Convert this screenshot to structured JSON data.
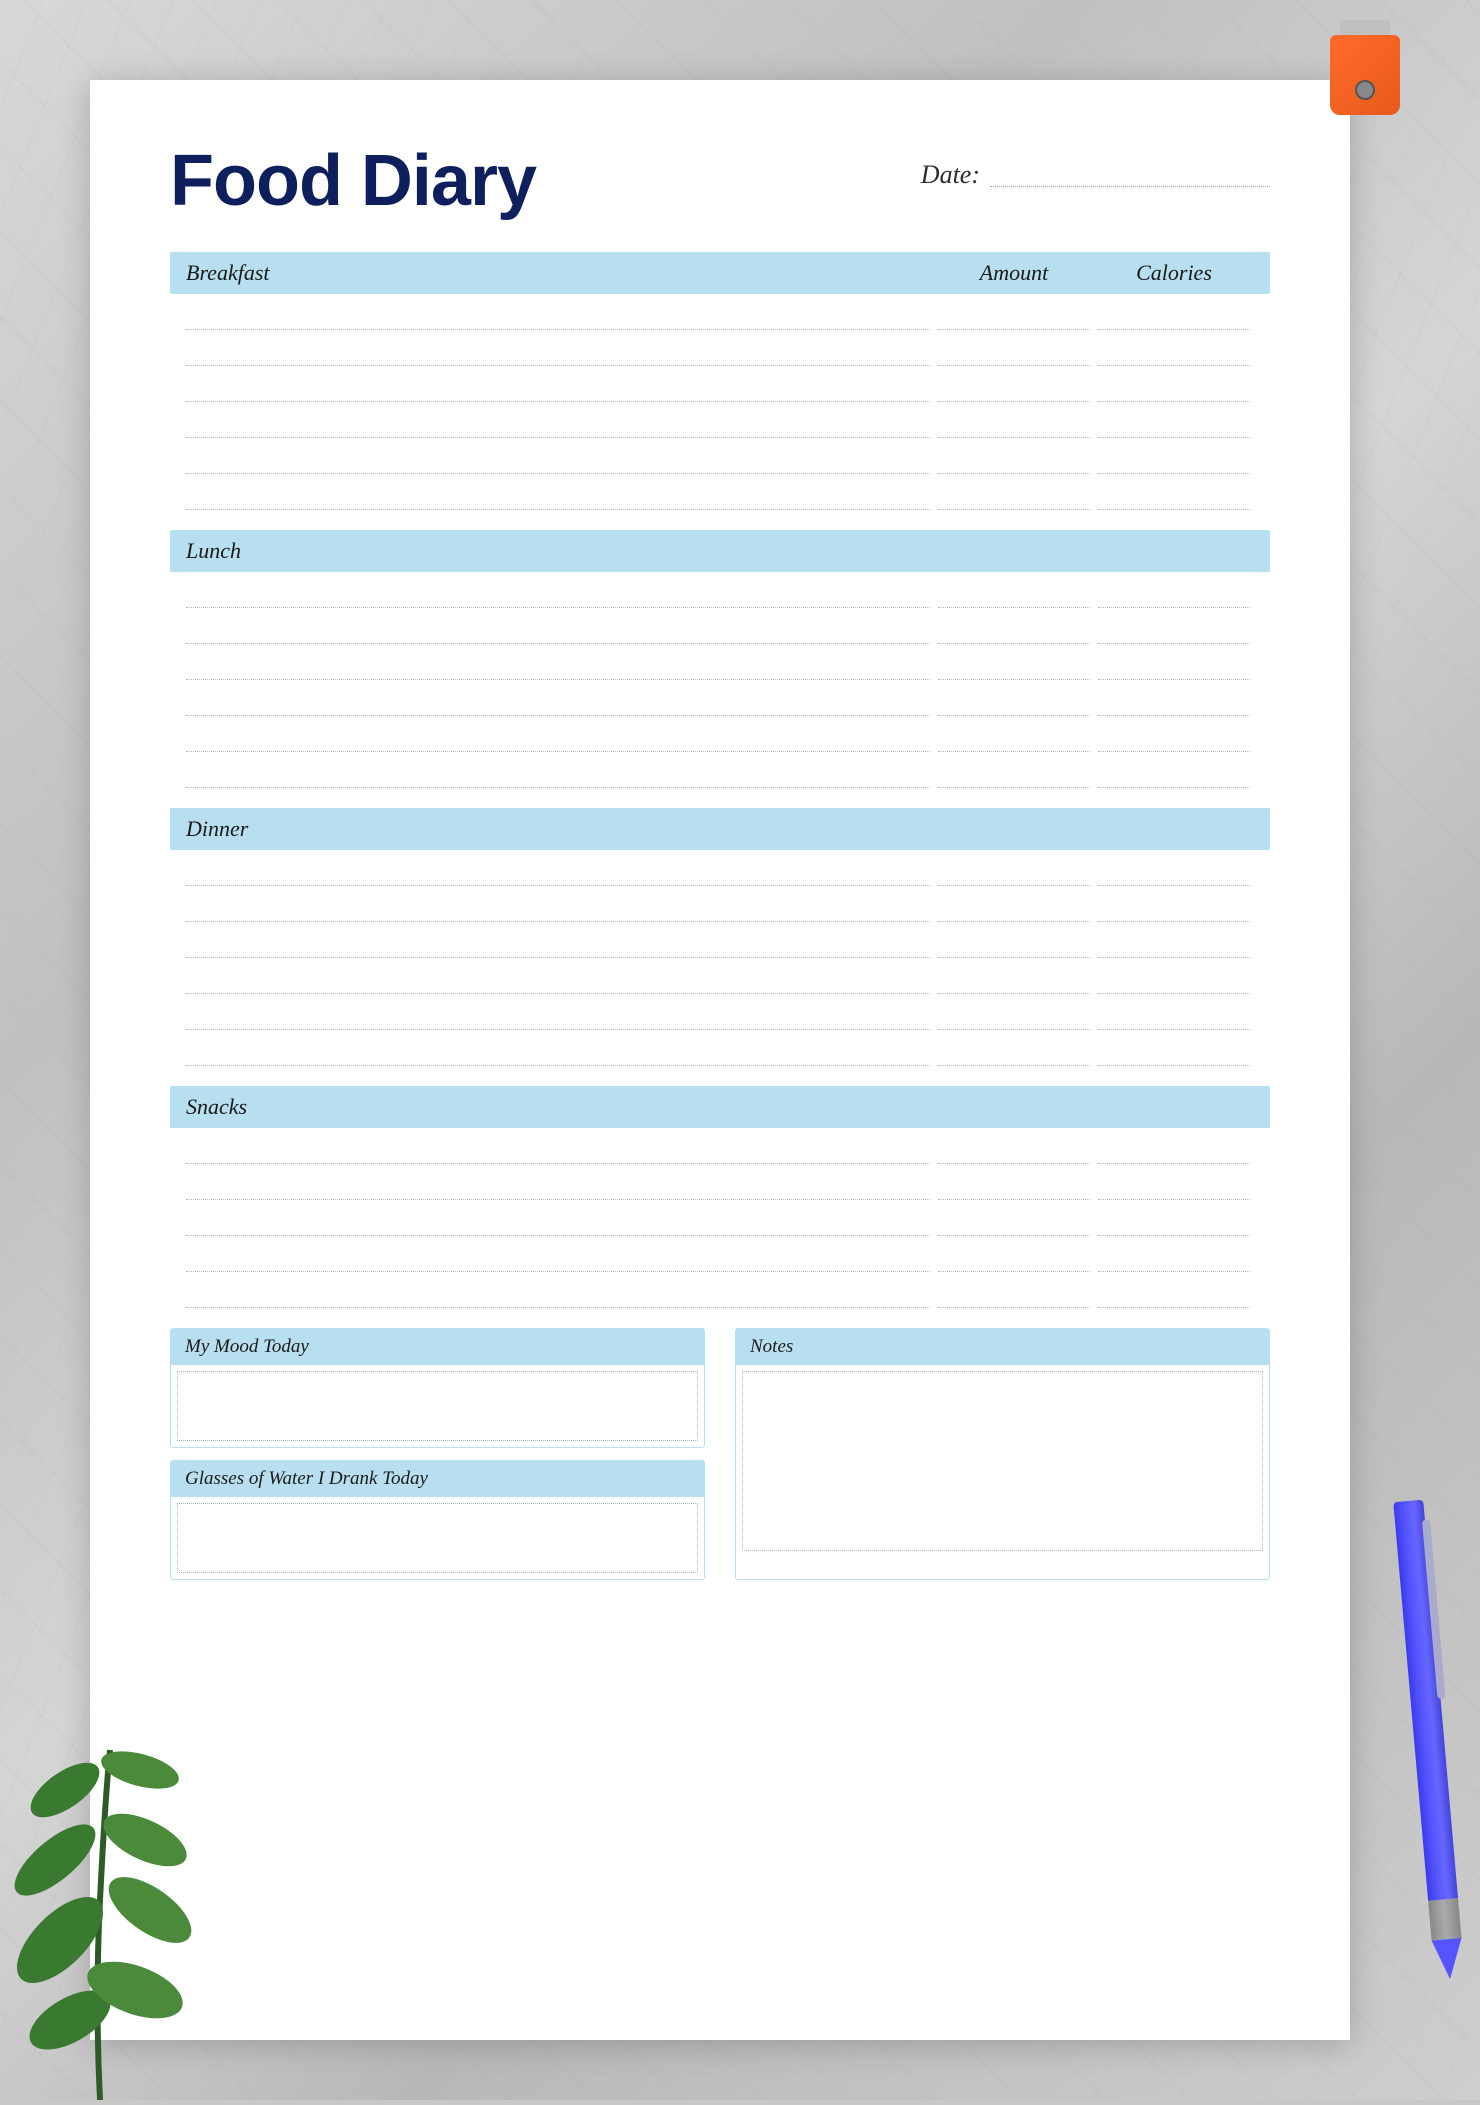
{
  "page": {
    "title": "Food Diary",
    "date_label": "Date:",
    "sections": [
      {
        "id": "breakfast",
        "label": "Breakfast",
        "rows": 6
      },
      {
        "id": "lunch",
        "label": "Lunch",
        "rows": 6
      },
      {
        "id": "dinner",
        "label": "Dinner",
        "rows": 6
      },
      {
        "id": "snacks",
        "label": "Snacks",
        "rows": 5
      }
    ],
    "columns": {
      "amount": "Amount",
      "calories": "Calories"
    },
    "bottom": {
      "mood_label": "My Mood Today",
      "water_label": "Glasses of Water I Drank Today",
      "notes_label": "Notes"
    }
  }
}
